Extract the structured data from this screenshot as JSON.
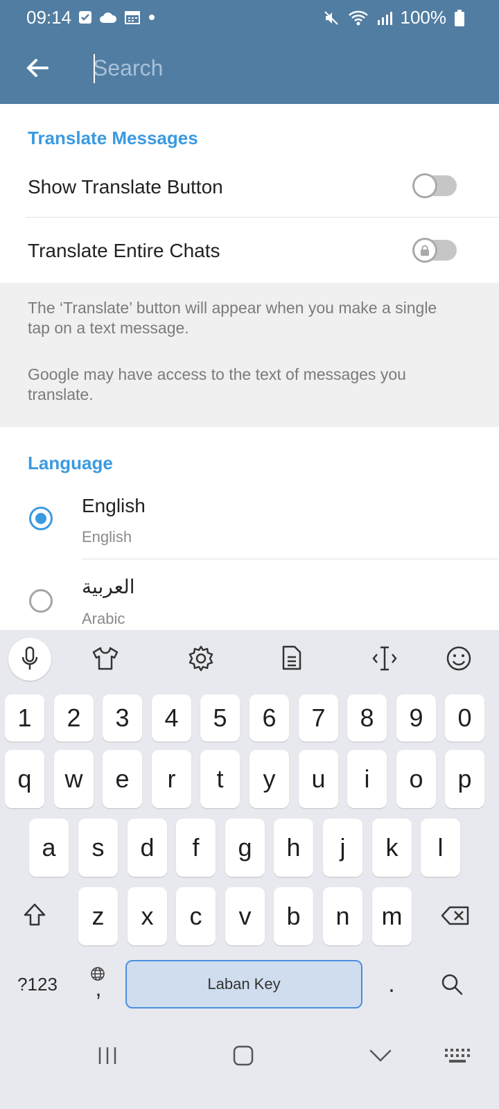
{
  "status": {
    "time": "09:14",
    "battery": "100%"
  },
  "header": {
    "search_placeholder": "Search"
  },
  "translate": {
    "section_title": "Translate Messages",
    "show_button_label": "Show Translate Button",
    "entire_chats_label": "Translate Entire Chats",
    "show_button_enabled": false,
    "entire_chats_locked": true,
    "info_1": "The ‘Translate’ button will appear when you make a single tap on a text message.",
    "info_2": "Google may have access to the text of messages you translate."
  },
  "language": {
    "section_title": "Language",
    "items": [
      {
        "name": "English",
        "subtitle": "English",
        "selected": true
      },
      {
        "name": "العربية",
        "subtitle": "Arabic",
        "selected": false
      }
    ]
  },
  "keyboard": {
    "toolbar_icons": [
      "microphone-icon",
      "theme-icon",
      "settings-icon",
      "clipboard-icon",
      "cursor-icon",
      "emoji-icon"
    ],
    "number_row": [
      "1",
      "2",
      "3",
      "4",
      "5",
      "6",
      "7",
      "8",
      "9",
      "0"
    ],
    "row1": [
      "q",
      "w",
      "e",
      "r",
      "t",
      "y",
      "u",
      "i",
      "o",
      "p"
    ],
    "row2": [
      "a",
      "s",
      "d",
      "f",
      "g",
      "h",
      "j",
      "k",
      "l"
    ],
    "row3": [
      "z",
      "x",
      "c",
      "v",
      "b",
      "n",
      "m"
    ],
    "symbols_label": "?123",
    "comma_label": ",",
    "space_label": "Laban Key",
    "period_label": "."
  },
  "colors": {
    "header": "#517da2",
    "accent": "#3a9ae0"
  }
}
